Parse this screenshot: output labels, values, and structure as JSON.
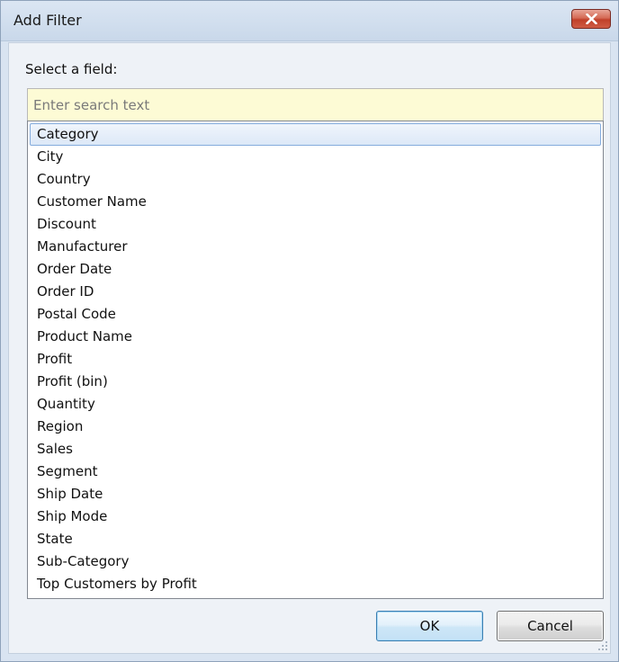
{
  "window": {
    "title": "Add Filter",
    "close_icon": "close-icon"
  },
  "dialog": {
    "field_label": "Select a field:",
    "search_placeholder": "Enter search text",
    "search_value": "",
    "selected_field": "Category",
    "fields": [
      "Category",
      "City",
      "Country",
      "Customer Name",
      "Discount",
      "Manufacturer",
      "Order Date",
      "Order ID",
      "Postal Code",
      "Product Name",
      "Profit",
      "Profit (bin)",
      "Quantity",
      "Region",
      "Sales",
      "Segment",
      "Ship Date",
      "Ship Mode",
      "State",
      "Sub-Category",
      "Top Customers by Profit"
    ],
    "ok_label": "OK",
    "cancel_label": "Cancel"
  },
  "colors": {
    "selection_border": "#84acdd",
    "close_button": "#c0402a",
    "search_background": "#fdfbd5"
  }
}
